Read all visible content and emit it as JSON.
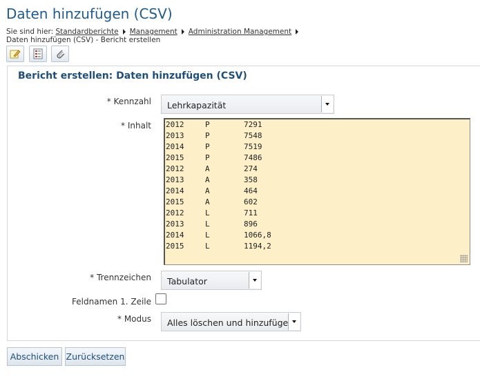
{
  "header": {
    "title": "Daten hinzufügen (CSV)",
    "breadcrumb": {
      "prefix": "Sie sind hier:",
      "links": [
        "Standardberichte",
        "Management",
        "Administration Management"
      ],
      "current": "Daten hinzufügen (CSV) - Bericht erstellen"
    }
  },
  "toolbar": {
    "icons": [
      "edit-icon",
      "list-icon",
      "attachment-icon"
    ]
  },
  "form": {
    "title": "Bericht erstellen: Daten hinzufügen (CSV)",
    "kennzahl": {
      "label": "* Kennzahl",
      "value": "Lehrkapazität"
    },
    "inhalt": {
      "label": "* Inhalt",
      "rows": [
        [
          "2012",
          "P",
          "7291"
        ],
        [
          "2013",
          "P",
          "7548"
        ],
        [
          "2014",
          "P",
          "7519"
        ],
        [
          "2015",
          "P",
          "7486"
        ],
        [
          "2012",
          "A",
          "274"
        ],
        [
          "2013",
          "A",
          "358"
        ],
        [
          "2014",
          "A",
          "464"
        ],
        [
          "2015",
          "A",
          "602"
        ],
        [
          "2012",
          "L",
          "711"
        ],
        [
          "2013",
          "L",
          "896"
        ],
        [
          "2014",
          "L",
          "1066,8"
        ],
        [
          "2015",
          "L",
          "1194,2"
        ]
      ]
    },
    "trennzeichen": {
      "label": "* Trennzeichen",
      "value": "Tabulator"
    },
    "feldnamen": {
      "label": "Feldnamen 1. Zeile",
      "checked": false
    },
    "modus": {
      "label": "* Modus",
      "value": "Alles löschen und hinzufügen"
    }
  },
  "actions": {
    "submit_label": "Abschicken",
    "reset_label": "Zurücksetzen"
  },
  "colors": {
    "title": "#1f5c8c",
    "textarea_bg": "#fdefc8",
    "button_text": "#1f4e79"
  }
}
